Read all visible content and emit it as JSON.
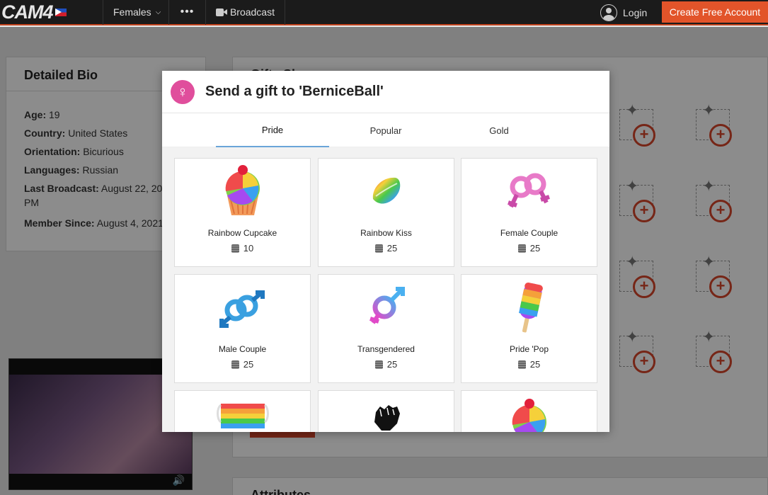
{
  "nav": {
    "logo": "CAM4",
    "females": "Females",
    "more": "•••",
    "broadcast": "Broadcast",
    "login": "Login",
    "create_account": "Create Free Account"
  },
  "bio": {
    "title": "Detailed Bio",
    "rows": [
      {
        "label": "Age:",
        "value": " 19"
      },
      {
        "label": "Country:",
        "value": " United States"
      },
      {
        "label": "Orientation:",
        "value": " Bicurious"
      },
      {
        "label": "Languages:",
        "value": " Russian"
      },
      {
        "label": "Last Broadcast:",
        "value": " August 22, 20"
      },
      {
        "label": "",
        "value": "PM"
      },
      {
        "label": "Member Since:",
        "value": " August 4, 2021"
      }
    ]
  },
  "gifts_showcase_title": "Gifts Showcase",
  "attributes_title": "Attributes",
  "modal": {
    "title": "Send a gift to 'BerniceBall'",
    "tabs": [
      "Pride",
      "Popular",
      "Gold"
    ],
    "active_tab": "Pride",
    "gifts": [
      {
        "name": "Rainbow Cupcake",
        "price": "10",
        "icon": "cupcake-icon"
      },
      {
        "name": "Rainbow Kiss",
        "price": "25",
        "icon": "lips-icon"
      },
      {
        "name": "Female Couple",
        "price": "25",
        "icon": "female-couple-icon"
      },
      {
        "name": "Male Couple",
        "price": "25",
        "icon": "male-couple-icon"
      },
      {
        "name": "Transgendered",
        "price": "25",
        "icon": "transgender-icon"
      },
      {
        "name": "Pride 'Pop",
        "price": "25",
        "icon": "popsicle-icon"
      },
      {
        "name": "",
        "price": "",
        "icon": "rainbow-mask-icon"
      },
      {
        "name": "",
        "price": "",
        "icon": "fist-icon"
      },
      {
        "name": "",
        "price": "",
        "icon": "cupcake-icon"
      }
    ]
  }
}
